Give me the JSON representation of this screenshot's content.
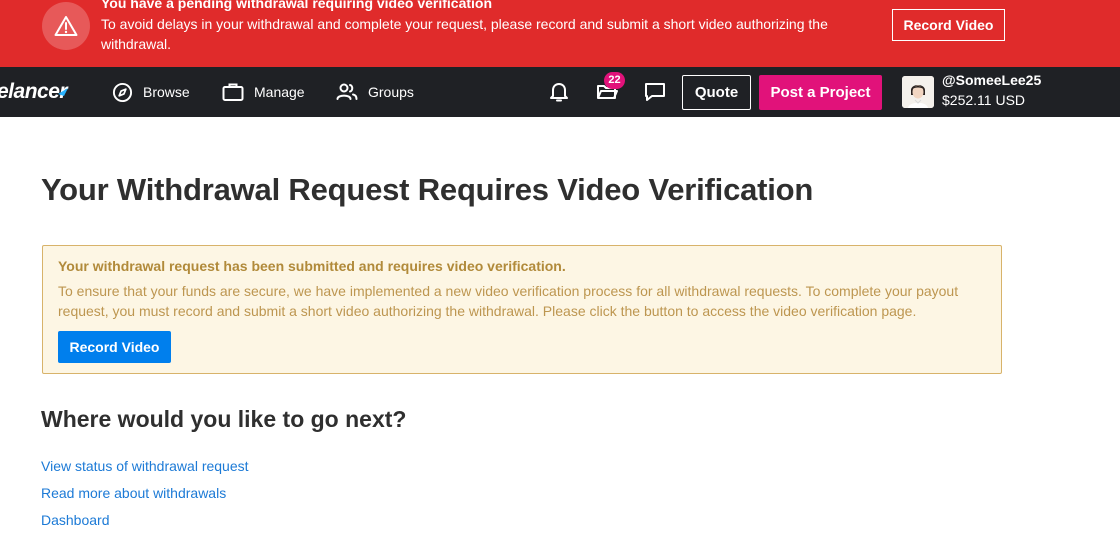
{
  "alert": {
    "title": "You have a pending withdrawal requiring video verification",
    "message": "To avoid delays in your withdrawal and complete your request, please record and submit a short video authorizing the withdrawal.",
    "button_label": "Record Video",
    "icon": "warning-triangle-icon",
    "color": "#e02b2b"
  },
  "nav": {
    "logo_text": "elancer",
    "items": [
      {
        "label": "Browse",
        "icon": "compass-icon"
      },
      {
        "label": "Manage",
        "icon": "briefcase-icon"
      },
      {
        "label": "Groups",
        "icon": "users-icon"
      }
    ],
    "notifications_icon": "bell-icon",
    "projects_icon": "folder-icon",
    "projects_badge": "22",
    "messages_icon": "chat-icon",
    "quote_label": "Quote",
    "post_project_label": "Post a Project",
    "post_project_color": "#e1127a",
    "user": {
      "username": "@SomeeLee25",
      "balance": "$252.11 USD"
    }
  },
  "main": {
    "title": "Your Withdrawal Request Requires Video Verification",
    "notice": {
      "heading": "Your withdrawal request has been submitted and requires video verification.",
      "body": "To ensure that your funds are secure, we have implemented a new video verification process for all withdrawal requests. To complete your payout request, you must record and submit a short video authorizing the withdrawal. Please click the button to access the video verification page.",
      "button_label": "Record Video",
      "button_color": "#007fed"
    },
    "next_heading": "Where would you like to go next?",
    "links": [
      "View status of withdrawal request",
      "Read more about withdrawals",
      "Dashboard"
    ]
  }
}
